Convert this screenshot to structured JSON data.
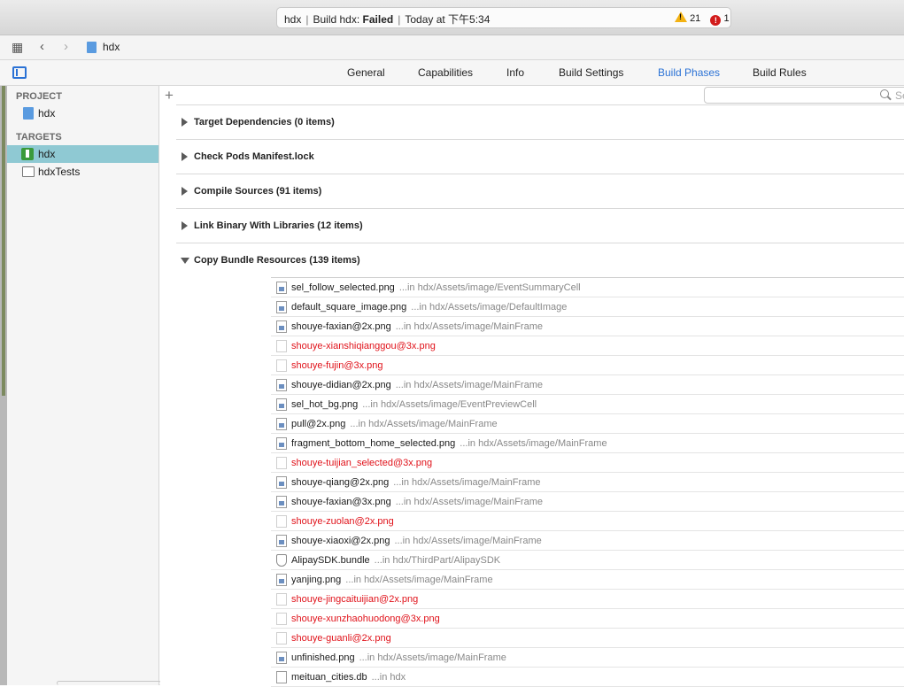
{
  "activity": {
    "project": "hdx",
    "build_prefix": "Build hdx:",
    "status": "Failed",
    "time": "Today at 下午5:34",
    "warnings": "21",
    "errors": "1"
  },
  "jumpbar": {
    "crumb": "hdx"
  },
  "tabs": [
    "General",
    "Capabilities",
    "Info",
    "Build Settings",
    "Build Phases",
    "Build Rules"
  ],
  "active_tab": "Build Phases",
  "sidebar": {
    "project_header": "PROJECT",
    "project_item": "hdx",
    "targets_header": "TARGETS",
    "targets": [
      "hdx",
      "hdxTests"
    ]
  },
  "filter": {
    "placeholder": "Se"
  },
  "phases": [
    "Target Dependencies (0 items)",
    "Check Pods Manifest.lock",
    "Compile Sources (91 items)",
    "Link Binary With Libraries (12 items)",
    "Copy Bundle Resources (139 items)"
  ],
  "files": [
    {
      "name": "sel_follow_selected.png",
      "path": "...in hdx/Assets/image/EventSummaryCell",
      "missing": false,
      "kind": "img"
    },
    {
      "name": "default_square_image.png",
      "path": "...in hdx/Assets/image/DefaultImage",
      "missing": false,
      "kind": "img"
    },
    {
      "name": "shouye-faxian@2x.png",
      "path": "...in hdx/Assets/image/MainFrame",
      "missing": false,
      "kind": "img"
    },
    {
      "name": "shouye-xianshiqianggou@3x.png",
      "path": "",
      "missing": true,
      "kind": "img"
    },
    {
      "name": "shouye-fujin@3x.png",
      "path": "",
      "missing": true,
      "kind": "img"
    },
    {
      "name": "shouye-didian@2x.png",
      "path": "...in hdx/Assets/image/MainFrame",
      "missing": false,
      "kind": "img"
    },
    {
      "name": "sel_hot_bg.png",
      "path": "...in hdx/Assets/image/EventPreviewCell",
      "missing": false,
      "kind": "img"
    },
    {
      "name": "pull@2x.png",
      "path": "...in hdx/Assets/image/MainFrame",
      "missing": false,
      "kind": "img"
    },
    {
      "name": "fragment_bottom_home_selected.png",
      "path": "...in hdx/Assets/image/MainFrame",
      "missing": false,
      "kind": "img"
    },
    {
      "name": "shouye-tuijian_selected@3x.png",
      "path": "",
      "missing": true,
      "kind": "img"
    },
    {
      "name": "shouye-qiang@2x.png",
      "path": "...in hdx/Assets/image/MainFrame",
      "missing": false,
      "kind": "img"
    },
    {
      "name": "shouye-faxian@3x.png",
      "path": "...in hdx/Assets/image/MainFrame",
      "missing": false,
      "kind": "img"
    },
    {
      "name": "shouye-zuolan@2x.png",
      "path": "",
      "missing": true,
      "kind": "img"
    },
    {
      "name": "shouye-xiaoxi@2x.png",
      "path": "...in hdx/Assets/image/MainFrame",
      "missing": false,
      "kind": "img"
    },
    {
      "name": "AlipaySDK.bundle",
      "path": "...in hdx/ThirdPart/AlipaySDK",
      "missing": false,
      "kind": "bundle"
    },
    {
      "name": "yanjing.png",
      "path": "...in hdx/Assets/image/MainFrame",
      "missing": false,
      "kind": "img"
    },
    {
      "name": "shouye-jingcaituijian@2x.png",
      "path": "",
      "missing": true,
      "kind": "img"
    },
    {
      "name": "shouye-xunzhaohuodong@3x.png",
      "path": "",
      "missing": true,
      "kind": "img"
    },
    {
      "name": "shouye-guanli@2x.png",
      "path": "",
      "missing": true,
      "kind": "img"
    },
    {
      "name": "unfinished.png",
      "path": "...in hdx/Assets/image/MainFrame",
      "missing": false,
      "kind": "img"
    },
    {
      "name": "meituan_cities.db",
      "path": "...in hdx",
      "missing": false,
      "kind": "doc"
    }
  ],
  "colors": {
    "accent": "#2b72d5",
    "missing": "#e0121a",
    "selection": "#8fc9d3"
  }
}
